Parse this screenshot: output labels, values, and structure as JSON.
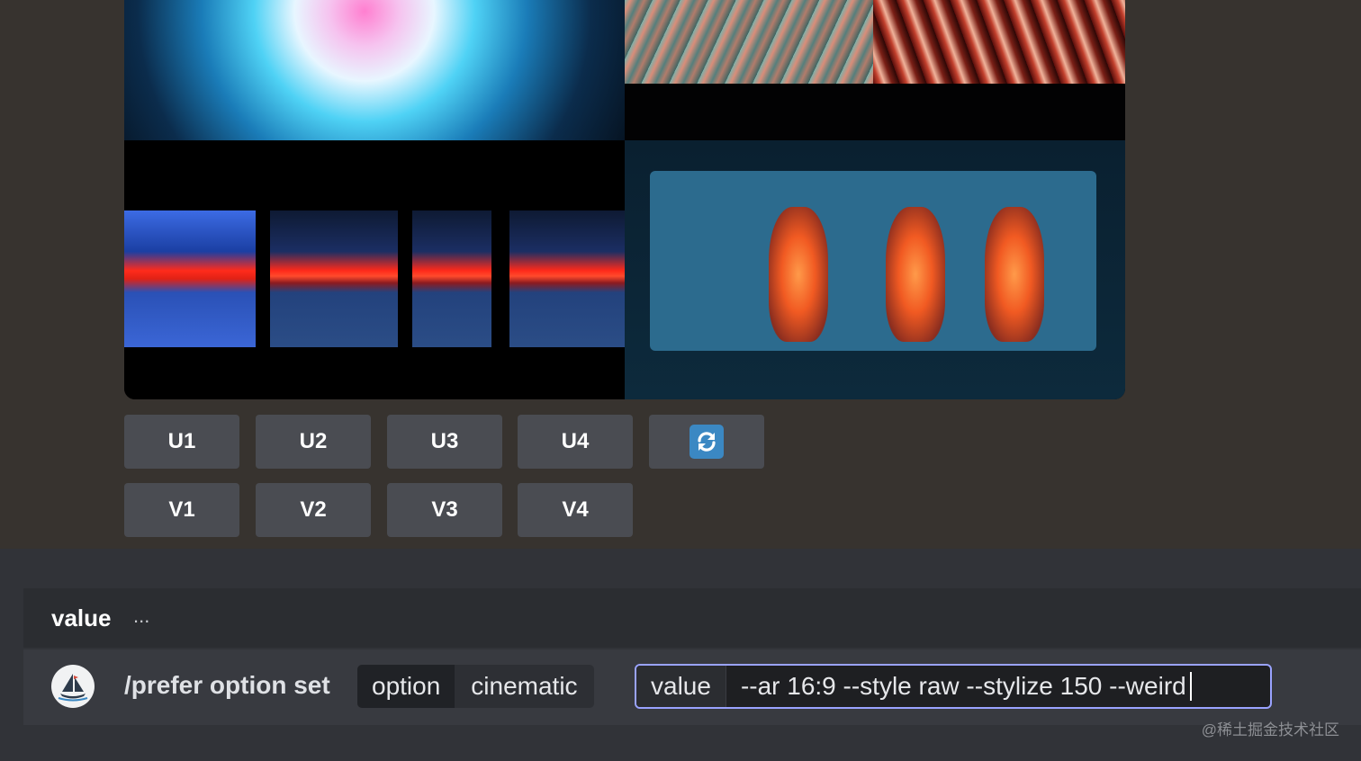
{
  "grid": {
    "images": [
      "cosmic-burst",
      "feather-streaks",
      "red-horizon-strips",
      "forest-fire-frame"
    ]
  },
  "buttons": {
    "upscale": [
      "U1",
      "U2",
      "U3",
      "U4"
    ],
    "variation": [
      "V1",
      "V2",
      "V3",
      "V4"
    ],
    "reroll_icon": "refresh-icon"
  },
  "composer": {
    "hint_label": "value",
    "hint_dots": "...",
    "command": "/prefer option set",
    "option_key": "option",
    "option_value": "cinematic",
    "value_key": "value",
    "value_text": "--ar 16:9 --style raw --stylize 150 --weird"
  },
  "watermark": "@稀土掘金技术社区",
  "colors": {
    "button_bg": "#4a4c52",
    "reroll_bg": "#3b88c3",
    "focus_border": "#9aa3ff"
  }
}
